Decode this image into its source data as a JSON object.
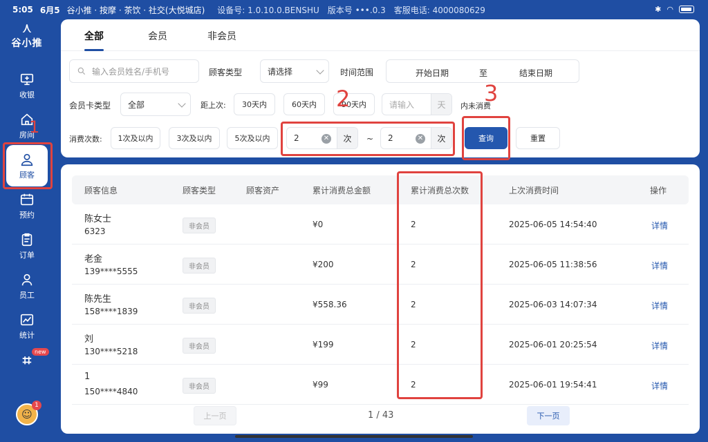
{
  "status_bar": {
    "time": "5:05",
    "date": "6月5",
    "store": "谷小推 · 按摩 · 茶饮 · 社交(大悦城店)",
    "device": "设备号: 1.0.10.0.BENSHU",
    "version": "版本号 •••.0.3",
    "phone": "客服电话:  4000080629"
  },
  "logo": {
    "mark": "⋏",
    "brand": "谷小推"
  },
  "sidebar": {
    "items": [
      {
        "label": "收银",
        "icon": "monitor-icon"
      },
      {
        "label": "房间",
        "icon": "house-icon"
      },
      {
        "label": "顾客",
        "icon": "user-icon"
      },
      {
        "label": "预约",
        "icon": "calendar-icon"
      },
      {
        "label": "订单",
        "icon": "clipboard-icon"
      },
      {
        "label": "员工",
        "icon": "people-icon"
      },
      {
        "label": "统计",
        "icon": "chart-icon"
      }
    ],
    "new_tag": "new",
    "avatar_count": "1"
  },
  "tabs": [
    "全部",
    "会员",
    "非会员"
  ],
  "filters": {
    "search_placeholder": "输入会员姓名/手机号",
    "customer_type_label": "顾客类型",
    "customer_type_value": "请选择",
    "time_range_label": "时间范围",
    "start_date": "开始日期",
    "to": "至",
    "end_date": "结束日期",
    "card_type_label": "会员卡类型",
    "card_type_value": "全部",
    "since_last_label": "距上次:",
    "since_buttons": [
      "30天内",
      "60天内",
      "90天内"
    ],
    "days_placeholder": "请输入",
    "days_unit": "天",
    "no_spend_suffix": "内未消费",
    "count_label": "消费次数:",
    "count_buttons": [
      "1次及以内",
      "3次及以内",
      "5次及以内"
    ],
    "count_min": "2",
    "count_max": "2",
    "count_unit": "次",
    "tilde": "~",
    "query": "查询",
    "reset": "重置"
  },
  "annotations": [
    "1",
    "2",
    "3"
  ],
  "table": {
    "headers": [
      "顾客信息",
      "顾客类型",
      "顾客资产",
      "累计消费总金额",
      "累计消费总次数",
      "上次消费时间",
      "操作"
    ],
    "rows": [
      {
        "name": "陈女士",
        "phone": "6323",
        "type": "非会员",
        "amount": "¥0",
        "count": "2",
        "last": "2025-06-05 14:54:40",
        "action": "详情"
      },
      {
        "name": "老金",
        "phone": "139****5555",
        "type": "非会员",
        "amount": "¥200",
        "count": "2",
        "last": "2025-06-05 11:38:56",
        "action": "详情"
      },
      {
        "name": "陈先生",
        "phone": "158****1839",
        "type": "非会员",
        "amount": "¥558.36",
        "count": "2",
        "last": "2025-06-03 14:07:34",
        "action": "详情"
      },
      {
        "name": "刘",
        "phone": "130****5218",
        "type": "非会员",
        "amount": "¥199",
        "count": "2",
        "last": "2025-06-01 20:25:54",
        "action": "详情"
      },
      {
        "name": "1",
        "phone": "150****4840",
        "type": "非会员",
        "amount": "¥99",
        "count": "2",
        "last": "2025-06-01 19:54:41",
        "action": "详情"
      }
    ]
  },
  "pagination": {
    "prev": "上一页",
    "page": "1 / 43",
    "next": "下一页"
  }
}
